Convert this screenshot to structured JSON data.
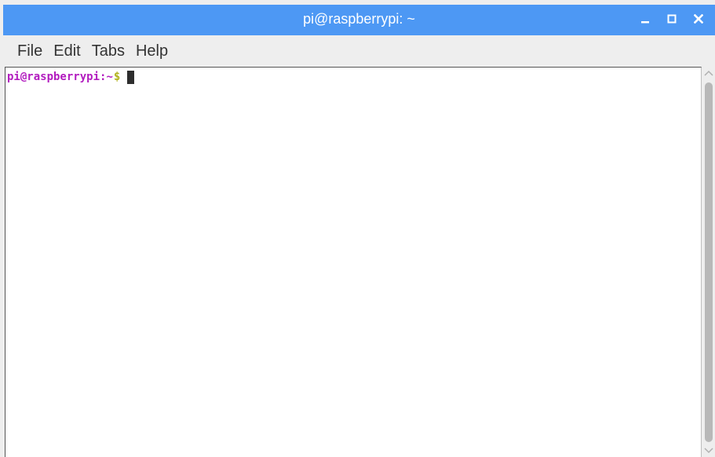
{
  "window": {
    "title": "pi@raspberrypi: ~",
    "controls": {
      "minimize": "minimize-icon",
      "maximize": "maximize-icon",
      "close": "close-icon"
    },
    "colors": {
      "titlebar": "#4d98f4",
      "menubar": "#eeeeee",
      "prompt_user": "#b21cbf",
      "prompt_sign": "#b2b21c"
    }
  },
  "menu": {
    "items": [
      "File",
      "Edit",
      "Tabs",
      "Help"
    ]
  },
  "terminal": {
    "prompt_user_host": "pi@raspberrypi",
    "prompt_separator": ":",
    "prompt_path": "~",
    "prompt_sign": "$"
  },
  "scrollbar": {
    "up_icon": "chevron-up-icon",
    "down_icon": "chevron-down-icon"
  }
}
